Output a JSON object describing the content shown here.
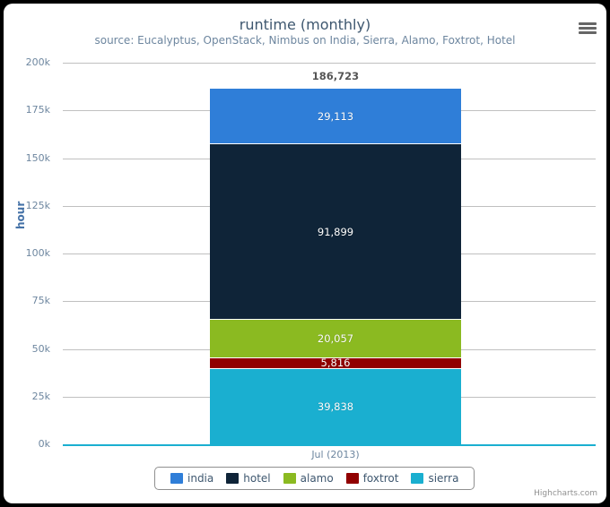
{
  "chart_data": {
    "type": "bar",
    "stacked": true,
    "title": "runtime (monthly)",
    "subtitle": "source: Eucalyptus, OpenStack, Nimbus on India, Sierra, Alamo, Foxtrot, Hotel",
    "xlabel": "",
    "ylabel": "hour",
    "categories": [
      "Jul (2013)"
    ],
    "ylim": [
      0,
      200000
    ],
    "ytick_values": [
      0,
      25000,
      50000,
      75000,
      100000,
      125000,
      150000,
      175000,
      200000
    ],
    "ytick_labels": [
      "0k",
      "25k",
      "50k",
      "75k",
      "100k",
      "125k",
      "150k",
      "175k",
      "200k"
    ],
    "grid": true,
    "legend_position": "bottom",
    "stack_total": 186723,
    "stack_total_label": "186,723",
    "series": [
      {
        "name": "india",
        "values": [
          29113
        ],
        "labels": [
          "29,113"
        ],
        "color": "#2f7ed8"
      },
      {
        "name": "hotel",
        "values": [
          91899
        ],
        "labels": [
          "91,899"
        ],
        "color": "#0f2438"
      },
      {
        "name": "alamo",
        "values": [
          20057
        ],
        "labels": [
          "20,057"
        ],
        "color": "#8bba21"
      },
      {
        "name": "foxtrot",
        "values": [
          5816
        ],
        "labels": [
          "5,816"
        ],
        "color": "#910000"
      },
      {
        "name": "sierra",
        "values": [
          39838
        ],
        "labels": [
          "39,838"
        ],
        "color": "#1aafd0"
      }
    ]
  },
  "toolbar": {
    "context_menu_icon": "hamburger-icon"
  },
  "credits": {
    "text": "Highcharts.com"
  },
  "colors": {
    "title": "#3E576F",
    "subtitle": "#6D869F",
    "axis_label": "#6D869F",
    "yaxis_title": "#4572A7",
    "gridline": "#C0C0C0",
    "baseline": "#1aafd0",
    "frame": "#000000",
    "plot_background": "#FFFFFF"
  }
}
